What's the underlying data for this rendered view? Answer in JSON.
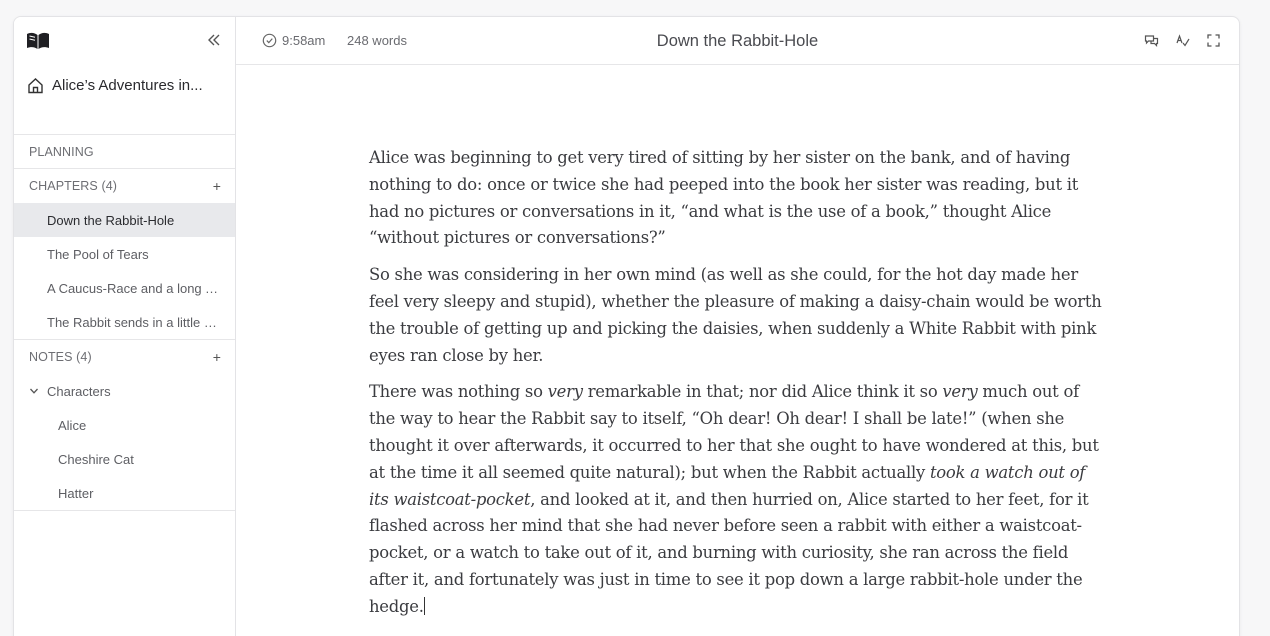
{
  "project": {
    "title": "Alice’s Adventures in..."
  },
  "sidebar": {
    "planning_label": "PLANNING",
    "chapters_label": "CHAPTERS (4)",
    "chapters": [
      "Down the Rabbit-Hole",
      "The Pool of Tears",
      "A Caucus-Race and a long Tale",
      "The Rabbit sends in a little Bill"
    ],
    "notes_label": "NOTES (4)",
    "folder_label": "Characters",
    "notes": [
      "Alice",
      "Cheshire Cat",
      "Hatter"
    ],
    "add_symbol": "+"
  },
  "topbar": {
    "time": "9:58am",
    "words": "248 words",
    "title": "Down the Rabbit-Hole"
  },
  "editor": {
    "p1": "Alice was beginning to get very tired of sitting by her sister on the bank, and of having nothing to do: once or twice she had peeped into the book her sister was reading, but it had no pictures or conversations in it, “and what is the use of a book,” thought Alice “without pictures or conversations?”",
    "p2": "So she was considering in her own mind (as well as she could, for the hot day made her feel very sleepy and stupid), whether the pleasure of making a daisy-chain would be worth the trouble of getting up and picking the daisies, when suddenly a White Rabbit with pink eyes ran close by her.",
    "p3_a": "There was nothing so ",
    "p3_b": "very",
    "p3_c": " remarkable in that; nor did Alice think it so ",
    "p3_d": "very",
    "p3_e": " much out of the way to hear the Rabbit say to itself, “Oh dear! Oh dear! I shall be late!” (when she thought it over afterwards, it occurred to her that she ought to have wondered at this, but at the time it all seemed quite natural); but when the Rabbit actually ",
    "p3_f": "took a watch out of its waistcoat-pocket",
    "p3_g": ", and looked at it, and then hurried on, Alice started to her feet, for it flashed across her mind that she had never before seen a rabbit with either a waistcoat-pocket, or a watch to take out of it, and burning with curiosity, she ran across the field after it, and fortunately was just in time to see it pop down a large rabbit-hole under the hedge."
  },
  "icons": {
    "logo": "open-book-logo",
    "collapse": "chevrons-left-icon",
    "home": "home-icon",
    "time": "check-circle-icon",
    "comments": "comments-icon",
    "spellcheck": "spellcheck-icon",
    "fullscreen": "fullscreen-icon"
  }
}
